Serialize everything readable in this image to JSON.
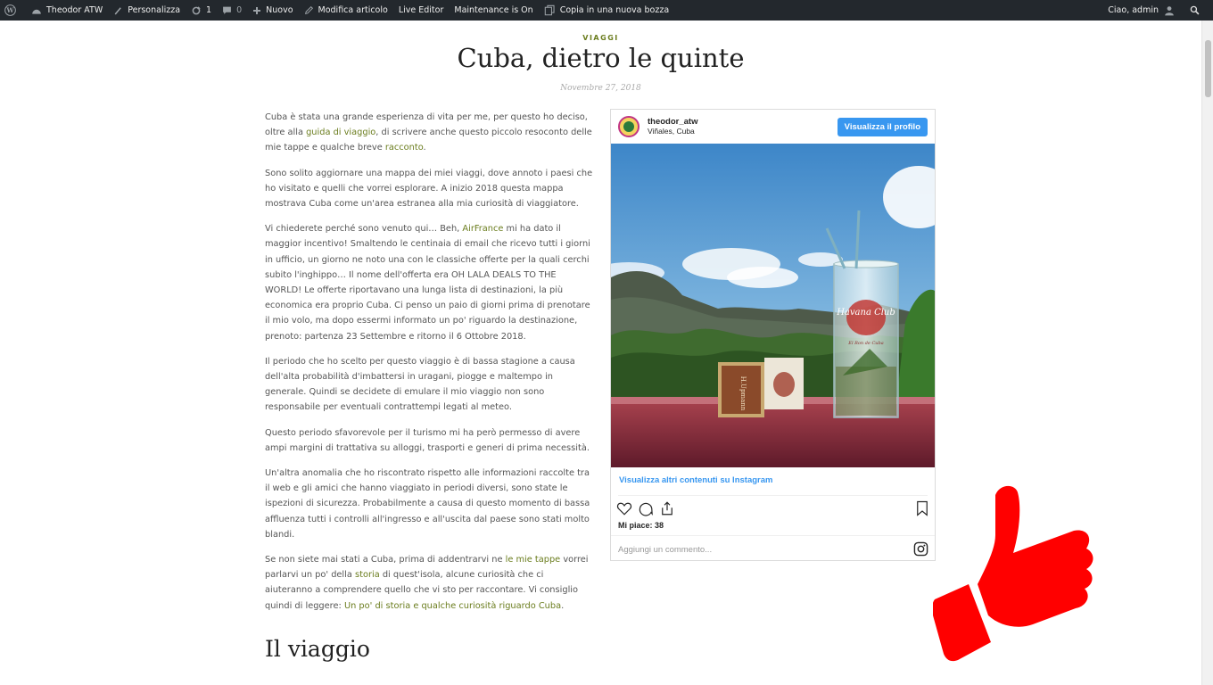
{
  "adminbar": {
    "site": "Theodor ATW",
    "customize": "Personalizza",
    "updates": "1",
    "comments": "0",
    "new": "Nuovo",
    "edit": "Modifica articolo",
    "live_editor": "Live Editor",
    "maintenance": "Maintenance is On",
    "copy": "Copia in una nuova bozza",
    "greeting": "Ciao, admin"
  },
  "post": {
    "category": "VIAGGI",
    "title": "Cuba, dietro le quinte",
    "date": "Novembre 27, 2018",
    "subheading": "Il viaggio"
  },
  "paragraphs": {
    "p1_a": "Cuba è stata una grande esperienza di vita per me, per questo ho deciso, oltre alla ",
    "p1_link1": "guida di viaggio",
    "p1_b": ", di scrivere anche questo piccolo resoconto delle mie tappe e qualche breve ",
    "p1_link2": "racconto",
    "p1_c": ".",
    "p2": "Sono solito aggiornare una mappa dei miei viaggi, dove annoto i paesi che ho visitato e quelli che vorrei esplorare. A inizio 2018 questa mappa mostrava Cuba come un'area estranea alla mia curiosità di viaggiatore.",
    "p3_a": "Vi chiederete perché sono venuto qui… Beh, ",
    "p3_link": "AirFrance",
    "p3_b": " mi ha dato il maggior incentivo! Smaltendo le centinaia di email che ricevo tutti i giorni in ufficio, un giorno ne noto una con le classiche offerte per la quali cerchi subito l'inghippo… Il nome dell'offerta era OH LALA DEALS TO THE WORLD! Le offerte riportavano una lunga lista di destinazioni, la più economica era proprio Cuba. Ci penso un paio di giorni prima di prenotare il mio volo, ma dopo essermi informato un po' riguardo la destinazione, prenoto: partenza 23 Settembre e ritorno il 6 Ottobre 2018.",
    "p4": "Il periodo che ho scelto per questo viaggio è di bassa stagione a causa dell'alta probabilità d'imbattersi in uragani, piogge e maltempo in generale. Quindi se decidete di emulare il mio viaggio non sono responsabile per eventuali contrattempi legati al meteo.",
    "p5": "Questo periodo sfavorevole per il turismo mi ha però permesso di avere ampi margini di trattativa su alloggi, trasporti e generi di prima necessità.",
    "p6": "Un'altra anomalia che ho riscontrato rispetto alle informazioni raccolte tra il web e gli amici che hanno viaggiato in periodi diversi, sono state le ispezioni di sicurezza. Probabilmente a causa di questo momento di bassa affluenza tutti i controlli all'ingresso e all'uscita dal paese sono stati molto blandi.",
    "p7_a": "Se non siete mai stati a Cuba, prima di addentrarvi ne ",
    "p7_link1": "le mie tappe",
    "p7_b": " vorrei parlarvi un po' della ",
    "p7_link2": "storia",
    "p7_c": " di quest'isola, alcune curiosità che ci aiuteranno a comprendere quello che vi sto per raccontare. Vi consiglio quindi di leggere: ",
    "p7_link3": "Un po' di storia e qualche curiosità riguardo Cuba",
    "p7_d": "."
  },
  "instagram": {
    "username": "theodor_atw",
    "location": "Viñales, Cuba",
    "profile_button": "Visualizza il profilo",
    "more_link": "Visualizza altri contenuti su Instagram",
    "likes": "Mi piace: 38",
    "comment_placeholder": "Aggiungi un commento...",
    "photo_text": {
      "glass_brand": "Havana Club",
      "glass_slogan": "El Ron de Cuba",
      "pack_brand": "H.Upmann"
    }
  },
  "colors": {
    "adminbar_bg": "#23282d",
    "link": "#6b7d1e",
    "ig_blue": "#3897f0",
    "thumb": "#ff0000"
  },
  "icons": [
    "wordpress-icon",
    "customize-icon",
    "updates-icon",
    "comments-icon",
    "plus-icon",
    "edit-icon",
    "copy-icon",
    "user-icon",
    "search-icon",
    "heart-icon",
    "comment-icon",
    "share-icon",
    "bookmark-icon",
    "instagram-icon",
    "thumbs-up-icon"
  ]
}
